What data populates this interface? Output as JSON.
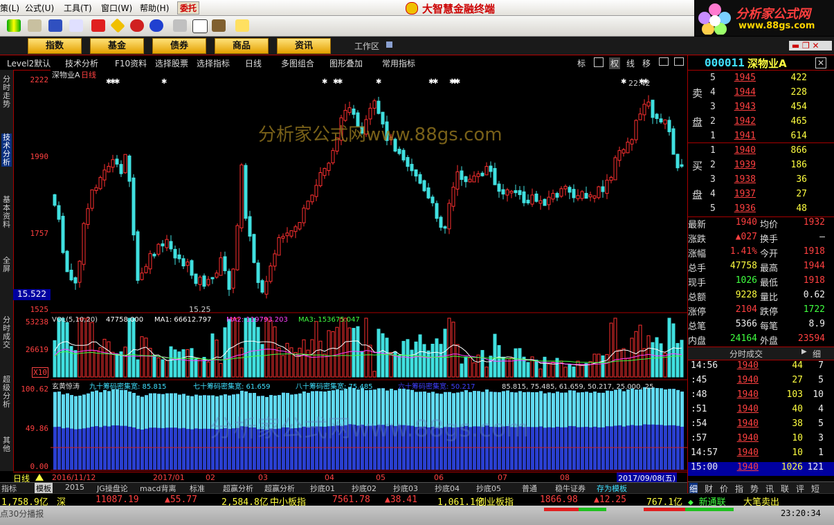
{
  "menu": {
    "items": [
      "策(L)",
      "公式(U)",
      "工具(T)",
      "窗口(W)",
      "帮助(H)"
    ],
    "trade": "委托"
  },
  "app_title": "大智慧金融终端",
  "brand": {
    "name": "分析家公式网",
    "url": "www.88gs.com"
  },
  "nav": {
    "buttons": [
      "指数",
      "基金",
      "债券",
      "商品",
      "资讯"
    ],
    "workspace": "工作区"
  },
  "chart_toolbar": {
    "items": [
      "Level2默认",
      "技术分析",
      "F10资料",
      "选择股票",
      "选择指标",
      "日线",
      "多图组合",
      "图形叠加",
      "常用指标"
    ],
    "right": [
      "标",
      "权",
      "线",
      "移"
    ]
  },
  "left_tabs": [
    "分时走势",
    "技术分析",
    "基本资料",
    "全屏",
    "分时成交",
    "超级分析",
    "其他"
  ],
  "price_chart": {
    "title": "深物业A",
    "period": "日线",
    "watermark": "分析家公式网www.88gs.com",
    "axis": [
      "2222",
      "1990",
      "1757",
      "1525"
    ],
    "current": "15.522",
    "low_label": "15.25",
    "high_label": "22.42"
  },
  "volume": {
    "axis": [
      "53238",
      "26619",
      "X10"
    ],
    "indicator": "VOL(5,10,20)",
    "vol": "47758.000",
    "ma1": "MA1: 66612.797",
    "ma2": "MA2: 119793.203",
    "ma3": "MA3: 153675.047"
  },
  "chip": {
    "axis": [
      "100.62",
      "49.86",
      "0.00"
    ],
    "name": "玄黄惊涛",
    "l90": "九十筹码密集宽: 85.815",
    "l70": "七十筹码密集宽: 61.659",
    "l80": "八十筹码密集宽: 75.485",
    "l60": "六十筹码密集宽: 50.217",
    "tail": "85.815, 75.485, 61.659, 50.217, 25.000, 25"
  },
  "date_axis": {
    "label": "日线",
    "dates": [
      "2016/11/12",
      "2017/01",
      "02",
      "03",
      "04",
      "05",
      "06",
      "07",
      "08"
    ],
    "end": "2017/09/08(五)"
  },
  "stock": {
    "code": "000011",
    "name": "深物业A"
  },
  "asks": [
    {
      "n": "5",
      "p": "1945",
      "v": "422"
    },
    {
      "n": "4",
      "p": "1944",
      "v": "228"
    },
    {
      "n": "3",
      "p": "1943",
      "v": "454"
    },
    {
      "n": "2",
      "p": "1942",
      "v": "465"
    },
    {
      "n": "1",
      "p": "1941",
      "v": "614"
    }
  ],
  "bids": [
    {
      "n": "1",
      "p": "1940",
      "v": "866"
    },
    {
      "n": "2",
      "p": "1939",
      "v": "186"
    },
    {
      "n": "3",
      "p": "1938",
      "v": "36"
    },
    {
      "n": "4",
      "p": "1937",
      "v": "27"
    },
    {
      "n": "5",
      "p": "1936",
      "v": "48"
    }
  ],
  "sell_label": [
    "卖",
    "盘"
  ],
  "buy_label": [
    "买",
    "盘"
  ],
  "quote": [
    {
      "l": "最新",
      "v": "1940",
      "l2": "均价",
      "v2": "1932"
    },
    {
      "l": "涨跌",
      "v": "▲027",
      "l2": "换手",
      "v2": "—"
    },
    {
      "l": "涨幅",
      "v": "1.41%",
      "l2": "今开",
      "v2": "1918"
    },
    {
      "l": "总手",
      "v": "47758",
      "l2": "最高",
      "v2": "1944"
    },
    {
      "l": "现手",
      "v": "1026",
      "l2": "最低",
      "v2": "1918"
    },
    {
      "l": "总额",
      "v": "9228",
      "l2": "量比",
      "v2": "0.62"
    },
    {
      "l": "涨停",
      "v": "2104",
      "l2": "跌停",
      "v2": "1722"
    },
    {
      "l": "总笔",
      "v": "5366",
      "l2": "每笔",
      "v2": "8.9"
    },
    {
      "l": "内盘",
      "v": "24164",
      "l2": "外盘",
      "v2": "23594"
    }
  ],
  "ticks_header": {
    "title": "分时成交",
    "tab": "细"
  },
  "ticks": [
    {
      "t": "14:56",
      "p": "1940",
      "v": "44",
      "n": "7"
    },
    {
      "t": ":45",
      "p": "1940",
      "v": "27",
      "n": "5"
    },
    {
      "t": ":48",
      "p": "1940",
      "v": "103",
      "n": "10"
    },
    {
      "t": ":51",
      "p": "1940",
      "v": "40",
      "n": "4"
    },
    {
      "t": ":54",
      "p": "1940",
      "v": "38",
      "n": "5"
    },
    {
      "t": ":57",
      "p": "1940",
      "v": "10",
      "n": "3"
    },
    {
      "t": "14:57",
      "p": "1940",
      "v": "10",
      "n": "1"
    },
    {
      "t": "15:00",
      "p": "1940",
      "v": "1026",
      "n": "121"
    }
  ],
  "right_tabs": [
    "细",
    "财",
    "价",
    "指",
    "势",
    "讯",
    "联",
    "评",
    "短"
  ],
  "bottom_tabs": [
    "指标",
    "模板",
    "2015",
    "JG操盘论",
    "macd背离",
    "标准",
    "超赢分析",
    "超赢分析",
    "抄底01",
    "抄底02",
    "抄底03",
    "抄底04",
    "抄底05",
    "普通",
    "稳牛证券",
    "存为模板"
  ],
  "ticker": [
    "1,758.9亿",
    "深",
    "11087.19",
    "▲55.77",
    "2,584.8亿",
    "中小板指",
    "7561.78",
    "▲38.41",
    "1,061.1亿",
    "创业板指",
    "1866.98",
    "▲12.25",
    "767.1亿"
  ],
  "ticker_right": {
    "a": "◆ 新通联",
    "b": "大笔卖出"
  },
  "status": {
    "left": "点30分播报",
    "time": "23:20:34"
  }
}
